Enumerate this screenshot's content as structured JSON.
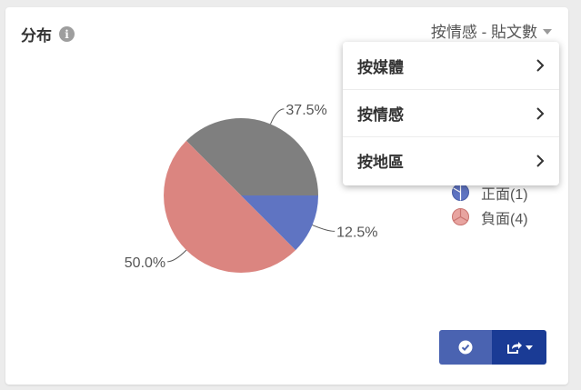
{
  "widget": {
    "title": "分布"
  },
  "sort": {
    "label": "按情感 - 貼文數"
  },
  "menu": {
    "items": [
      {
        "label": "按媒體"
      },
      {
        "label": "按情感"
      },
      {
        "label": "按地區"
      }
    ]
  },
  "legend": {
    "items": [
      {
        "label": "正面(1)",
        "color": "#5f74c2"
      },
      {
        "label": "負面(4)",
        "color": "#db8580"
      }
    ]
  },
  "chart_data": {
    "type": "pie",
    "slices": [
      {
        "label": "37.5%",
        "value": 37.5,
        "color": "#7f7f7f"
      },
      {
        "label": "50.0%",
        "value": 50.0,
        "color": "#db8580"
      },
      {
        "label": "12.5%",
        "value": 12.5,
        "color": "#5f74c2"
      }
    ]
  },
  "colors": {
    "check_button": "#4a63b1",
    "share_button": "#1a3b95"
  }
}
